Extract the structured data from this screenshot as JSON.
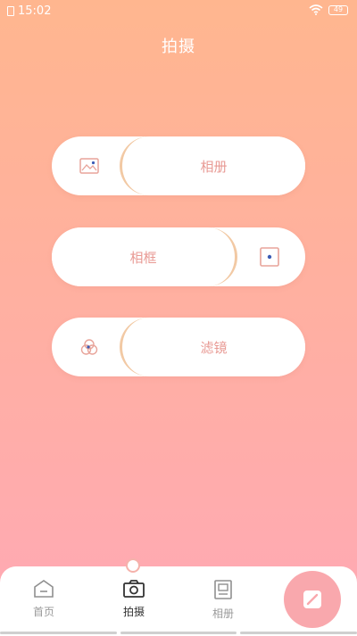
{
  "status_bar": {
    "time": "15:02",
    "battery": "49"
  },
  "page_title": "拍摄",
  "cards": [
    {
      "label": "相册",
      "icon": "image-icon"
    },
    {
      "label": "相框",
      "icon": "frame-icon"
    },
    {
      "label": "滤镜",
      "icon": "filter-icon"
    }
  ],
  "tabs": [
    {
      "label": "首页",
      "icon": "home-icon"
    },
    {
      "label": "拍摄",
      "icon": "camera-icon",
      "active": true
    },
    {
      "label": "相册",
      "icon": "album-icon"
    }
  ],
  "fab": {
    "icon": "edit-icon"
  },
  "colors": {
    "accent": "#e89a94",
    "fab": "#f9a8ad",
    "divider": "#f2c9a4"
  }
}
